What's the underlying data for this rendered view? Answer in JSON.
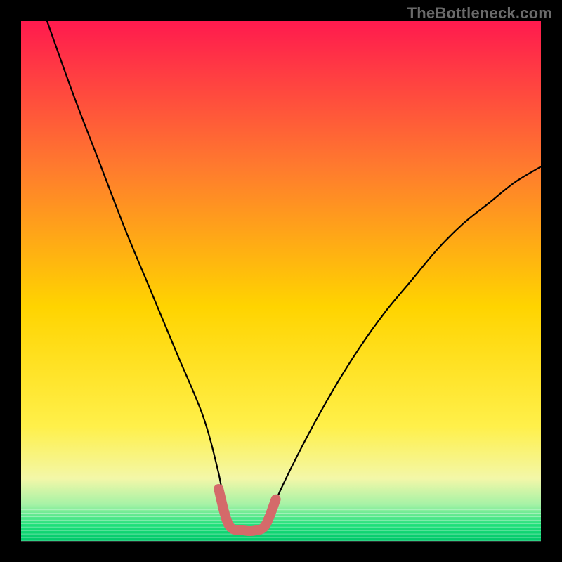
{
  "watermark": {
    "text": "TheBottleneck.com"
  },
  "colors": {
    "black": "#000000",
    "curve_stroke": "#000000",
    "trough_stroke": "#d46a6a",
    "gradient_top": "#ff1a4e",
    "gradient_mid_upper": "#ff7a2e",
    "gradient_mid": "#ffd400",
    "gradient_lower_yellow": "#fff04a",
    "gradient_pale": "#f3f7a8",
    "gradient_light_green": "#a6f2a6",
    "gradient_green": "#1fe07a",
    "gradient_deep_green": "#00c76a"
  },
  "chart_data": {
    "type": "line",
    "title": "",
    "xlabel": "",
    "ylabel": "",
    "xlim": [
      0,
      100
    ],
    "ylim": [
      0,
      100
    ],
    "note": "Bottleneck-style V curve. x is relative horizontal position (0–100, left→right); y is relative height (0 at bottom green band, 100 at top). The trough sits around x≈40–47 at y≈2.",
    "series": [
      {
        "name": "bottleneck-curve",
        "x": [
          5,
          10,
          15,
          20,
          25,
          30,
          35,
          38,
          40,
          43,
          45,
          47,
          50,
          55,
          60,
          65,
          70,
          75,
          80,
          85,
          90,
          95,
          100
        ],
        "y": [
          100,
          86,
          73,
          60,
          48,
          36,
          24,
          13,
          3,
          2,
          2,
          3,
          10,
          20,
          29,
          37,
          44,
          50,
          56,
          61,
          65,
          69,
          72
        ]
      }
    ],
    "trough_marker": {
      "name": "trough-highlight",
      "x": [
        38,
        40,
        43,
        45,
        47,
        49
      ],
      "y": [
        10,
        3,
        2,
        2,
        3,
        8
      ]
    },
    "green_band_top_y": 6
  }
}
